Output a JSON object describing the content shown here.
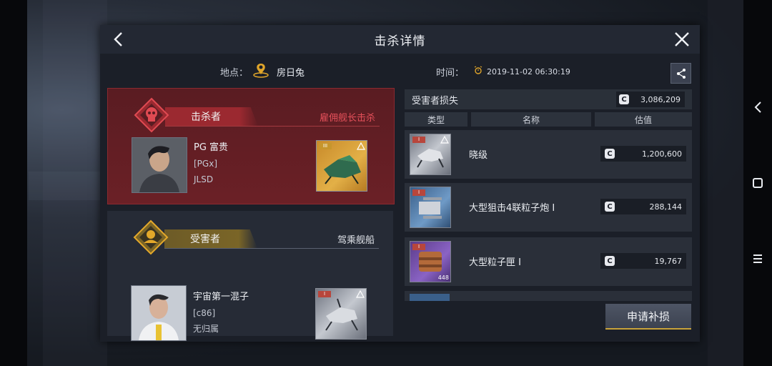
{
  "dialog": {
    "title": "击杀详情"
  },
  "info": {
    "location_label": "地点：",
    "location_value": "房日兔",
    "time_label": "时间：",
    "time_value": "2019-11-02 06:30:19"
  },
  "killer": {
    "role": "击杀者",
    "tag": "雇佣舰长击杀",
    "name": "PG 富贵",
    "corp": "[PGx]",
    "alliance": "JLSD",
    "ship_tier": "III"
  },
  "victim": {
    "role": "受害者",
    "tag": "驾乘舰船",
    "name": "宇宙第一混子",
    "corp": "[c86]",
    "alliance": "无归属",
    "ship_tier": "I"
  },
  "losses": {
    "header": "受害者损失",
    "total": "3,086,209",
    "columns": [
      "类型",
      "名称",
      "估值"
    ],
    "items": [
      {
        "name": "晓级",
        "value": "1,200,600",
        "tier": "I",
        "count": ""
      },
      {
        "name": "大型狙击4联粒子炮 I",
        "value": "288,144",
        "tier": "I",
        "count": ""
      },
      {
        "name": "大型粒子匣 I",
        "value": "19,767",
        "tier": "I",
        "count": "448"
      }
    ]
  },
  "actions": {
    "claim_label": "申请补损"
  },
  "icons": {
    "coin": "C"
  },
  "colors": {
    "killer_accent": "#9b2930",
    "victim_accent": "#d19a2a",
    "kill_tag": "#e4505a"
  }
}
